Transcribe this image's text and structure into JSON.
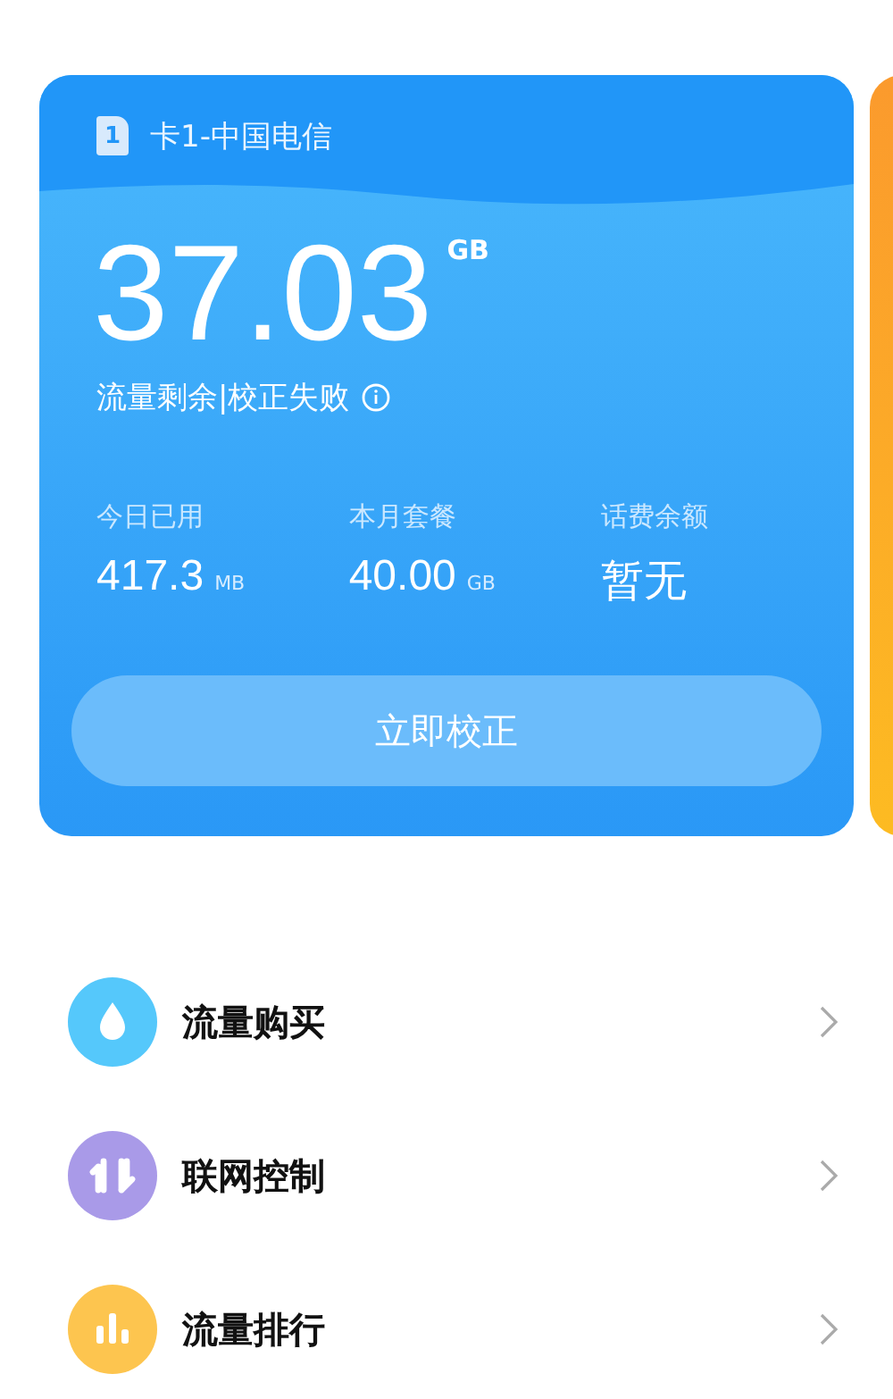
{
  "sim_card": {
    "badge": "1",
    "label": "卡1-中国电信"
  },
  "remaining": {
    "value": "37.03",
    "unit": "GB",
    "caption": "流量剩余|校正失败"
  },
  "stats": [
    {
      "label": "今日已用",
      "value": "417.3",
      "unit": "MB"
    },
    {
      "label": "本月套餐",
      "value": "40.00",
      "unit": "GB"
    },
    {
      "label": "话费余额",
      "value": "暂无"
    }
  ],
  "calibrate_button": "立即校正",
  "menu": [
    {
      "label": "流量购买",
      "kind": "drop",
      "color": "#55c8fb"
    },
    {
      "label": "联网控制",
      "kind": "updown",
      "color": "#a99ae8"
    },
    {
      "label": "流量排行",
      "kind": "bars",
      "color": "#fdc54f"
    }
  ]
}
